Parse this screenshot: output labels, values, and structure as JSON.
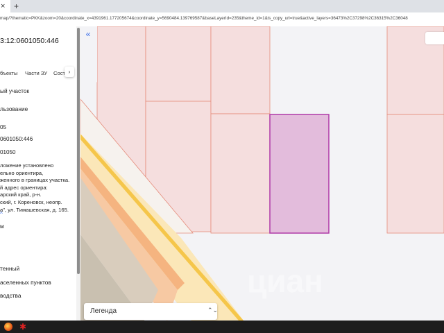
{
  "browser": {
    "tab_close_glyph": "×",
    "new_tab_glyph": "+",
    "url": "map/?thematic=PKK&zoom=20&coordinate_x=4391961.177205674&coordinate_y=5690484.139769587&baseLayerId=235&theme_id=1&is_copy_url=true&active_layers=36473%2C37298%2C36315%2C36048"
  },
  "sidebar": {
    "cadastral_number": "3:12:0601050:446",
    "tabs": [
      "бъекты",
      "Части ЗУ",
      "Соста"
    ],
    "tab_next_glyph": "›",
    "lines": {
      "type": "ый участок",
      "usage": "льзование",
      "num_05": "05",
      "number": "0601050:446",
      "quarter": "01050",
      "status": "тенный",
      "category": "аселенных пунктов",
      "purpose": "водства",
      "partial_m": "м"
    },
    "address_lines": [
      "ложение установлено",
      "ельно ориентира,",
      "женного в границах участка.",
      "й адрес ориентира:",
      "арский край, р-н.",
      "ский, г. Кореновск, неопр.",
      "а\", ул. Тимашевская, д. 165."
    ],
    "caret_glyph": "^"
  },
  "map": {
    "collapse_glyph": "«",
    "legend_label": "Легенда",
    "legend_toggle_glyph": "⌃⌄",
    "watermark": "циан"
  },
  "colors": {
    "parcel_fill": "#f5dede",
    "parcel_stroke": "#e58b7a",
    "selected_fill": "#e3bcdc",
    "selected_stroke": "#b03aa8",
    "road_yellow": "#f5c64a",
    "road_orange": "#f3a36e",
    "road_light": "#fbe7b8",
    "road_grey": "#d9cdbd"
  }
}
